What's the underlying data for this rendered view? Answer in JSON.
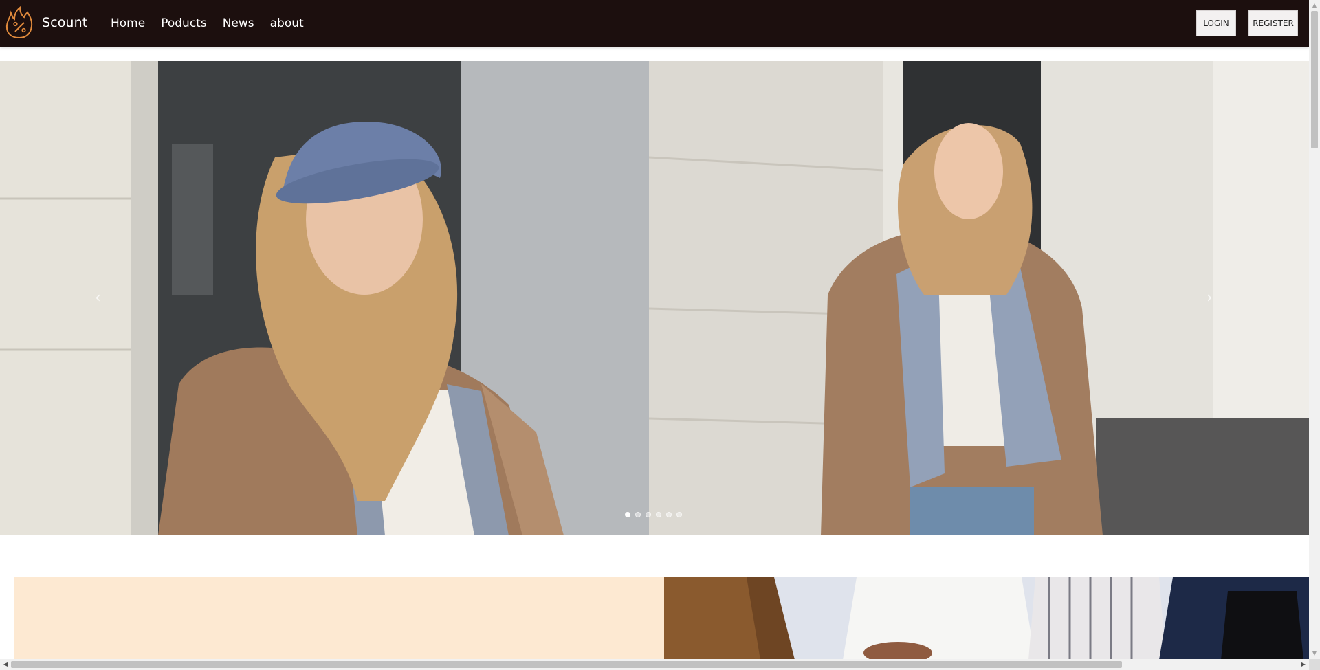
{
  "brand": {
    "name": "Scount",
    "logo_icon": "flame-percent-logo-icon"
  },
  "nav": {
    "links": [
      "Home",
      "Poducts",
      "News",
      "about"
    ],
    "login_label": "LOGIN",
    "register_label": "REGISTER"
  },
  "carousel": {
    "prev_glyph": "‹",
    "next_glyph": "›",
    "slide_count": 6,
    "active_index": 0
  },
  "colors": {
    "nav_bg": "#1c0f0e",
    "promo_bg": "#fde9d2",
    "accent_logo": "#e08a3c"
  }
}
